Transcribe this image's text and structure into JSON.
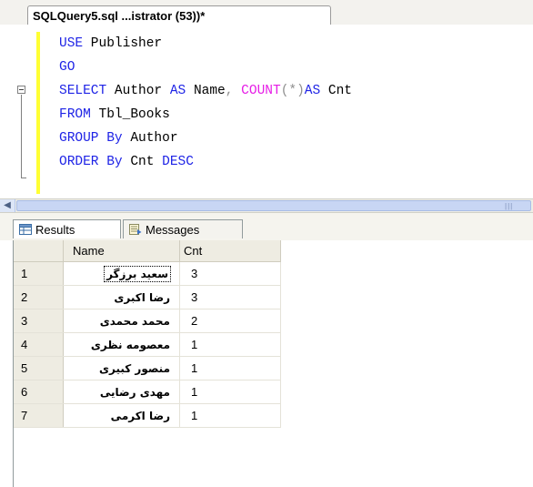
{
  "editor": {
    "tab_title": "SQLQuery5.sql ...istrator (53))*",
    "code": {
      "l1": {
        "kw": "USE",
        "tx": " Publisher"
      },
      "l2": {
        "kw": "GO"
      },
      "l3": {
        "kw1": "SELECT",
        "tx1": " Author ",
        "kw2": "AS",
        "tx2": " Name",
        "op1": ", ",
        "fn": "COUNT",
        "op2": "(*)",
        "kw3": "AS",
        "tx3": " Cnt"
      },
      "l4": {
        "kw": "FROM",
        "tx": " Tbl_Books"
      },
      "l5": {
        "kw": "GROUP By",
        "tx": " Author"
      },
      "l6": {
        "kw1": "ORDER By",
        "tx": " Cnt ",
        "kw2": "DESC"
      }
    }
  },
  "results_tabs": {
    "results": "Results",
    "messages": "Messages"
  },
  "grid": {
    "columns": {
      "name": "Name",
      "cnt": "Cnt"
    },
    "rows": [
      {
        "num": "1",
        "name": "سعید برزگر",
        "cnt": "3"
      },
      {
        "num": "2",
        "name": "رضا اکبری",
        "cnt": "3"
      },
      {
        "num": "3",
        "name": "محمد محمدی",
        "cnt": "2"
      },
      {
        "num": "4",
        "name": "معصومه نظری",
        "cnt": "1"
      },
      {
        "num": "5",
        "name": "منصور کبیری",
        "cnt": "1"
      },
      {
        "num": "6",
        "name": "مهدی رضایی",
        "cnt": "1"
      },
      {
        "num": "7",
        "name": "رضا اکرمی",
        "cnt": "1"
      }
    ]
  }
}
